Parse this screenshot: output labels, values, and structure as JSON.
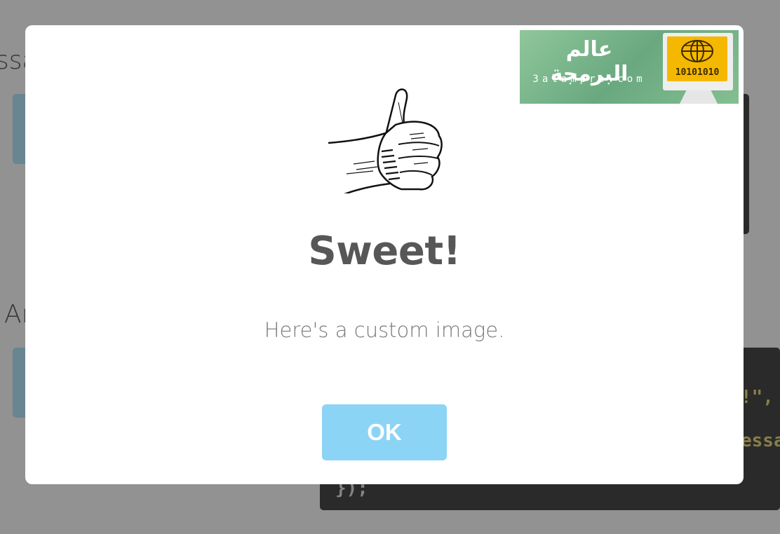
{
  "background": {
    "fragment_1": "ssa",
    "fragment_2": "Ar",
    "code_lines": [
      "!\",",
      "essa",
      "});"
    ]
  },
  "modal": {
    "title": "Sweet!",
    "message": "Here's a custom image.",
    "confirm_label": "OK",
    "image_icon": "thumbs-up-icon"
  },
  "watermark": {
    "arabic_text": "عالم البرمجة",
    "site": "3alampro.com",
    "binary": "10101010"
  },
  "colors": {
    "confirm_button": "#8cd4f5",
    "overlay": "rgba(0,0,0,0.4)",
    "code_bg": "#474747",
    "code_text": "#e2d47a"
  }
}
